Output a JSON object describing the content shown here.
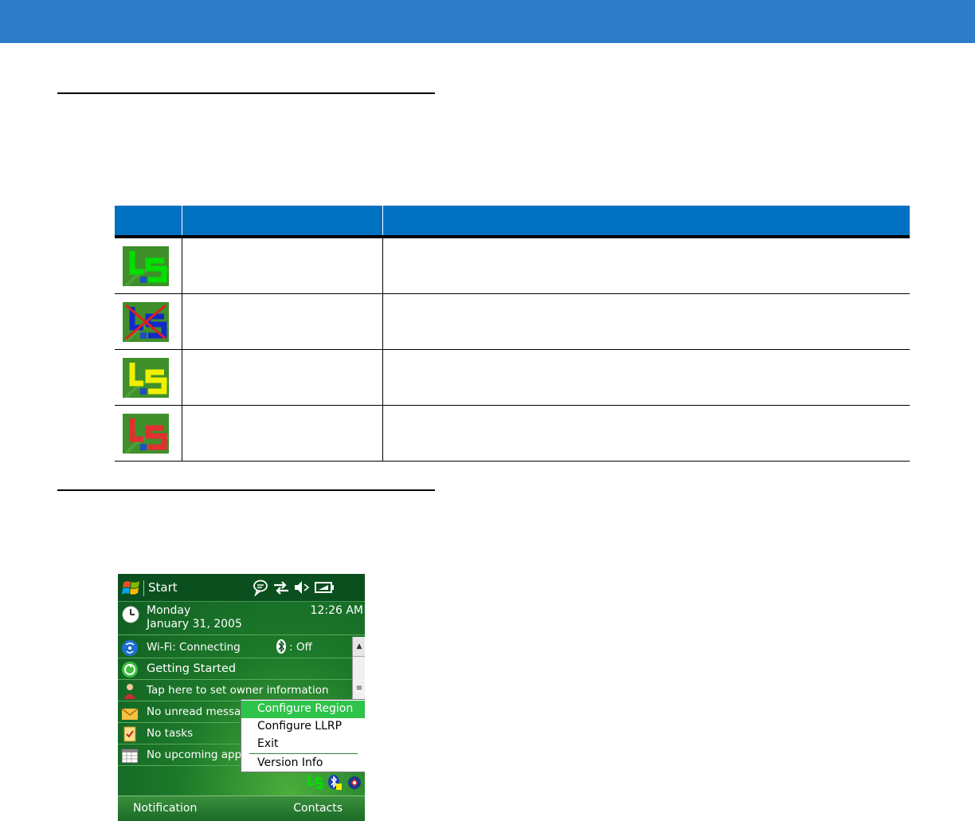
{
  "device": {
    "title_bar": {
      "start_label": "Start"
    },
    "date_block": {
      "day": "Monday",
      "date": "January 31, 2005",
      "time": "12:26 AM"
    },
    "today_items": [
      {
        "label": "Wi-Fi: Connecting",
        "icon": "wifi-icon"
      },
      {
        "label": "Getting Started",
        "icon": "getting-started-icon"
      },
      {
        "label": "Tap here to set owner information",
        "icon": "owner-icon"
      },
      {
        "label": "No unread message",
        "icon": "mail-icon"
      },
      {
        "label": "No tasks",
        "icon": "tasks-icon"
      },
      {
        "label": "No upcoming appoi",
        "icon": "calendar-icon"
      }
    ],
    "bluetooth_status": ": Off",
    "context_menu": [
      {
        "label": "Configure Region",
        "selected": true
      },
      {
        "label": "Configure LLRP",
        "selected": false
      },
      {
        "label": "Exit",
        "selected": false
      },
      {
        "label": "Version Info",
        "selected": false
      }
    ],
    "softkeys": {
      "left": "Notification",
      "right": "Contacts"
    }
  },
  "icon_table": {
    "rows": [
      {
        "icon_state": "green",
        "color": "#00e000"
      },
      {
        "icon_state": "crossed",
        "color": "#1428c8"
      },
      {
        "icon_state": "yellow",
        "color": "#f0f000"
      },
      {
        "icon_state": "red",
        "color": "#e03030"
      }
    ]
  },
  "colors": {
    "header_bar": "#2e7bc9",
    "table_header": "#0070c0",
    "menu_highlight": "#2ec34a"
  }
}
